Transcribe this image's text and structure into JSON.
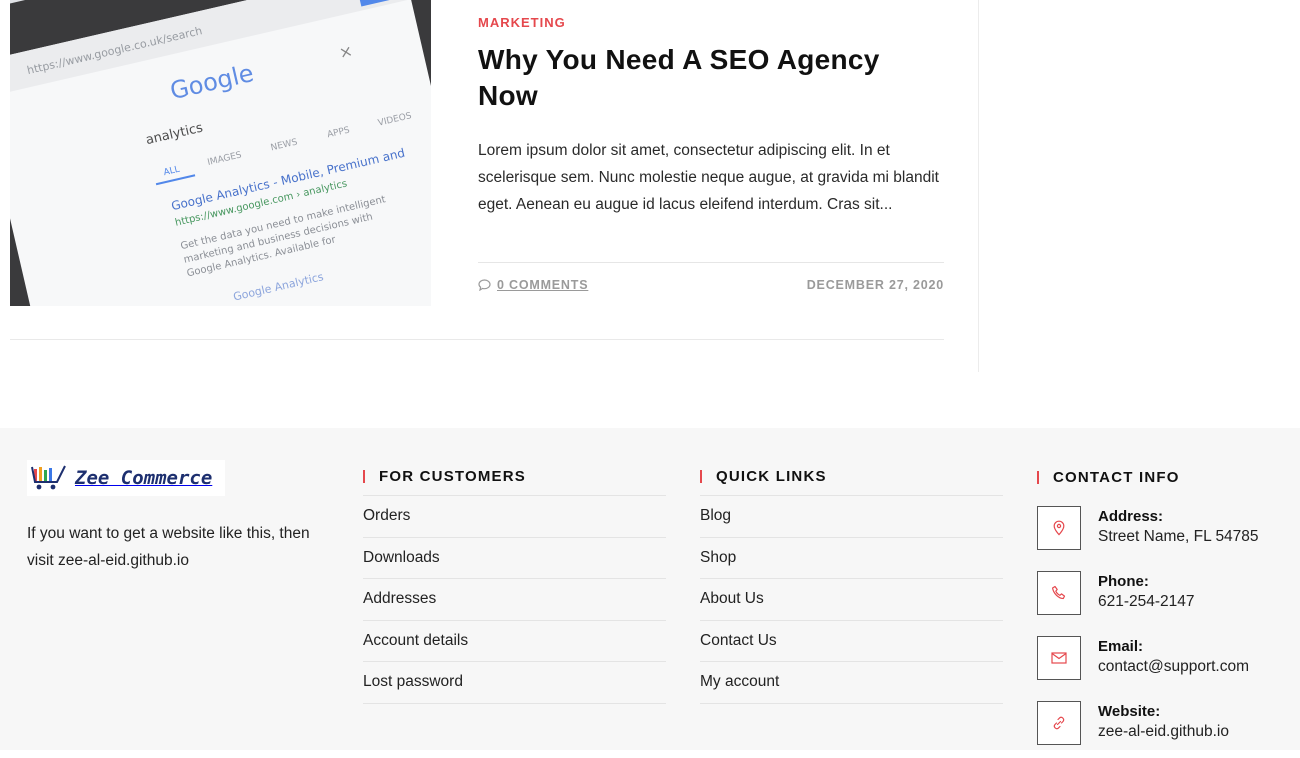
{
  "article": {
    "category": "MARKETING",
    "title": "Why You Need A SEO Agency Now",
    "excerpt": "Lorem ipsum dolor sit amet, consectetur adipiscing elit. In et scelerisque sem. Nunc molestie neque augue, at gravida mi blandit eget. Aenean eu augue id lacus eleifend interdum. Cras sit...",
    "comments": "0 COMMENTS",
    "date": "DECEMBER 27, 2020",
    "thumbnail": {
      "google_logo": "Google",
      "search_query": "analytics",
      "tabs": [
        "ALL",
        "IMAGES",
        "NEWS",
        "APPS",
        "VIDEOS"
      ],
      "result_title": "Google Analytics - Mobile, Premium and",
      "result_url": "https://www.google.com › analytics",
      "result_snippet": [
        "Get the data you need to make intelligent",
        "marketing and business decisions with",
        "Google Analytics. Available for"
      ],
      "result2_title": "Google Analytics"
    }
  },
  "footer": {
    "brand": {
      "logo_text": "Zee Commerce",
      "description": "If you want to get a website like this, then visit zee-al-eid.github.io"
    },
    "customers": {
      "heading": "FOR CUSTOMERS",
      "links": [
        "Orders",
        "Downloads",
        "Addresses",
        "Account details",
        "Lost password"
      ]
    },
    "quick_links": {
      "heading": "QUICK LINKS",
      "links": [
        "Blog",
        "Shop",
        "About Us",
        "Contact Us",
        "My account"
      ]
    },
    "contact": {
      "heading": "CONTACT INFO",
      "items": [
        {
          "icon": "location-pin-icon",
          "label": "Address:",
          "value": "Street Name, FL 54785"
        },
        {
          "icon": "phone-icon",
          "label": "Phone:",
          "value": "621-254-2147"
        },
        {
          "icon": "envelope-icon",
          "label": "Email:",
          "value": "contact@support.com"
        },
        {
          "icon": "link-icon",
          "label": "Website:",
          "value": "zee-al-eid.github.io"
        }
      ]
    }
  },
  "colors": {
    "accent": "#e5484d",
    "footer_bg": "#f7f7f7",
    "logo_text": "#1d2f6f"
  }
}
